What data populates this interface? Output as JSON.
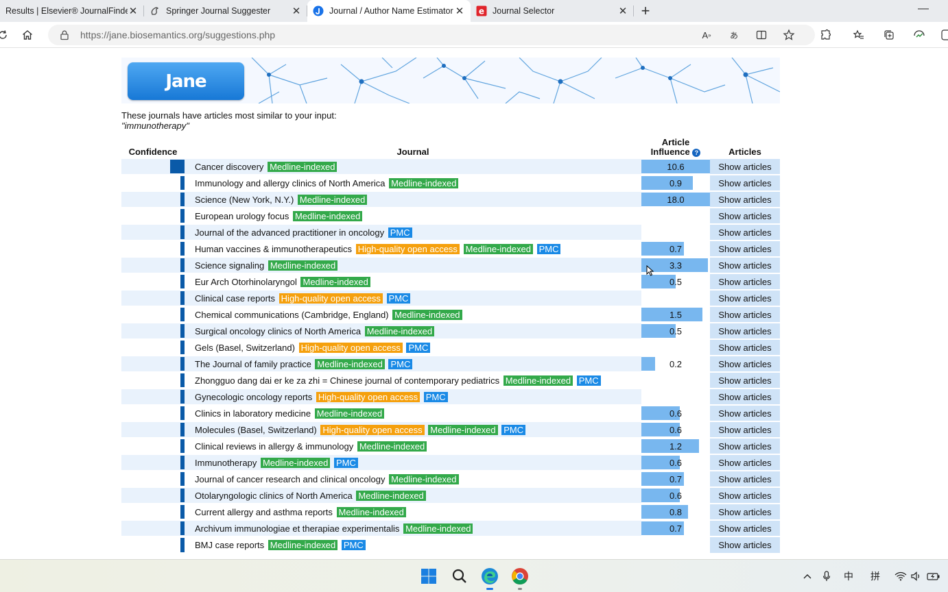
{
  "browser": {
    "tabs": [
      {
        "title": "Results | Elsevier® JournalFinder",
        "icon": "none",
        "active": false
      },
      {
        "title": "Springer Journal Suggester",
        "icon": "springer-icon",
        "active": false
      },
      {
        "title": "Journal / Author Name Estimator",
        "icon": "jane-icon",
        "active": true
      },
      {
        "title": "Journal Selector",
        "icon": "elsevier-e-icon",
        "active": false
      }
    ],
    "url_host": "https://jane.biosemantics.org",
    "url_path": "/suggestions.php"
  },
  "page": {
    "logo_text": "Jane",
    "intro_line": "These journals have articles most similar to your input:",
    "query": "\"immunotherapy\"",
    "headers": {
      "confidence": "Confidence",
      "journal": "Journal",
      "influence_line1": "Article",
      "influence_line2": "Influence",
      "articles": "Articles"
    },
    "show_articles_label": "Show articles",
    "badge_labels": {
      "medline": "Medline-indexed",
      "oa": "High-quality open access",
      "pmc": "PMC"
    }
  },
  "results": [
    {
      "journal": "Cancer discovery",
      "badges": [
        "medline"
      ],
      "influence": "10.6",
      "influence_fill": 1.0,
      "confidence": 1.0
    },
    {
      "journal": "Immunology and allergy clinics of North America",
      "badges": [
        "medline"
      ],
      "influence": "0.9",
      "influence_fill": 0.75,
      "confidence": 0.3
    },
    {
      "journal": "Science (New York, N.Y.)",
      "badges": [
        "medline"
      ],
      "influence": "18.0",
      "influence_fill": 1.0,
      "confidence": 0.3
    },
    {
      "journal": "European urology focus",
      "badges": [
        "medline"
      ],
      "influence": "",
      "influence_fill": 0,
      "confidence": 0.3
    },
    {
      "journal": "Journal of the advanced practitioner in oncology",
      "badges": [
        "pmc"
      ],
      "influence": "",
      "influence_fill": 0,
      "confidence": 0.3
    },
    {
      "journal": "Human vaccines & immunotherapeutics",
      "badges": [
        "oa",
        "medline",
        "pmc"
      ],
      "influence": "0.7",
      "influence_fill": 0.62,
      "confidence": 0.3
    },
    {
      "journal": "Science signaling",
      "badges": [
        "medline"
      ],
      "influence": "3.3",
      "influence_fill": 0.97,
      "confidence": 0.3
    },
    {
      "journal": "Eur Arch Otorhinolaryngol",
      "badges": [
        "medline"
      ],
      "influence": "0.5",
      "influence_fill": 0.5,
      "confidence": 0.3
    },
    {
      "journal": "Clinical case reports",
      "badges": [
        "oa",
        "pmc"
      ],
      "influence": "",
      "influence_fill": 0,
      "confidence": 0.3
    },
    {
      "journal": "Chemical communications (Cambridge, England)",
      "badges": [
        "medline"
      ],
      "influence": "1.5",
      "influence_fill": 0.89,
      "confidence": 0.3
    },
    {
      "journal": "Surgical oncology clinics of North America",
      "badges": [
        "medline"
      ],
      "influence": "0.5",
      "influence_fill": 0.5,
      "confidence": 0.3
    },
    {
      "journal": "Gels (Basel, Switzerland)",
      "badges": [
        "oa",
        "pmc"
      ],
      "influence": "",
      "influence_fill": 0,
      "confidence": 0.3
    },
    {
      "journal": "The Journal of family practice",
      "badges": [
        "medline",
        "pmc"
      ],
      "influence": "0.2",
      "influence_fill": 0.2,
      "confidence": 0.3
    },
    {
      "journal": "Zhongguo dang dai er ke za zhi = Chinese journal of contemporary pediatrics",
      "badges": [
        "medline",
        "pmc"
      ],
      "influence": "",
      "influence_fill": 0,
      "confidence": 0.3
    },
    {
      "journal": "Gynecologic oncology reports",
      "badges": [
        "oa",
        "pmc"
      ],
      "influence": "",
      "influence_fill": 0,
      "confidence": 0.3
    },
    {
      "journal": "Clinics in laboratory medicine",
      "badges": [
        "medline"
      ],
      "influence": "0.6",
      "influence_fill": 0.56,
      "confidence": 0.3
    },
    {
      "journal": "Molecules (Basel, Switzerland)",
      "badges": [
        "oa",
        "medline",
        "pmc"
      ],
      "influence": "0.6",
      "influence_fill": 0.56,
      "confidence": 0.3
    },
    {
      "journal": "Clinical reviews in allergy & immunology",
      "badges": [
        "medline"
      ],
      "influence": "1.2",
      "influence_fill": 0.84,
      "confidence": 0.3
    },
    {
      "journal": "Immunotherapy",
      "badges": [
        "medline",
        "pmc"
      ],
      "influence": "0.6",
      "influence_fill": 0.56,
      "confidence": 0.3
    },
    {
      "journal": "Journal of cancer research and clinical oncology",
      "badges": [
        "medline"
      ],
      "influence": "0.7",
      "influence_fill": 0.62,
      "confidence": 0.3
    },
    {
      "journal": "Otolaryngologic clinics of North America",
      "badges": [
        "medline"
      ],
      "influence": "0.6",
      "influence_fill": 0.56,
      "confidence": 0.3
    },
    {
      "journal": "Current allergy and asthma reports",
      "badges": [
        "medline"
      ],
      "influence": "0.8",
      "influence_fill": 0.68,
      "confidence": 0.3
    },
    {
      "journal": "Archivum immunologiae et therapiae experimentalis",
      "badges": [
        "medline"
      ],
      "influence": "0.7",
      "influence_fill": 0.62,
      "confidence": 0.3
    },
    {
      "journal": "BMJ case reports",
      "badges": [
        "medline",
        "pmc"
      ],
      "influence": "",
      "influence_fill": 0,
      "confidence": 0.3
    }
  ],
  "taskbar": {
    "items": [
      "windows-start-icon",
      "search-icon",
      "edge-icon",
      "chrome-icon"
    ],
    "tray_ime_1": "中",
    "tray_ime_2": "拼"
  }
}
